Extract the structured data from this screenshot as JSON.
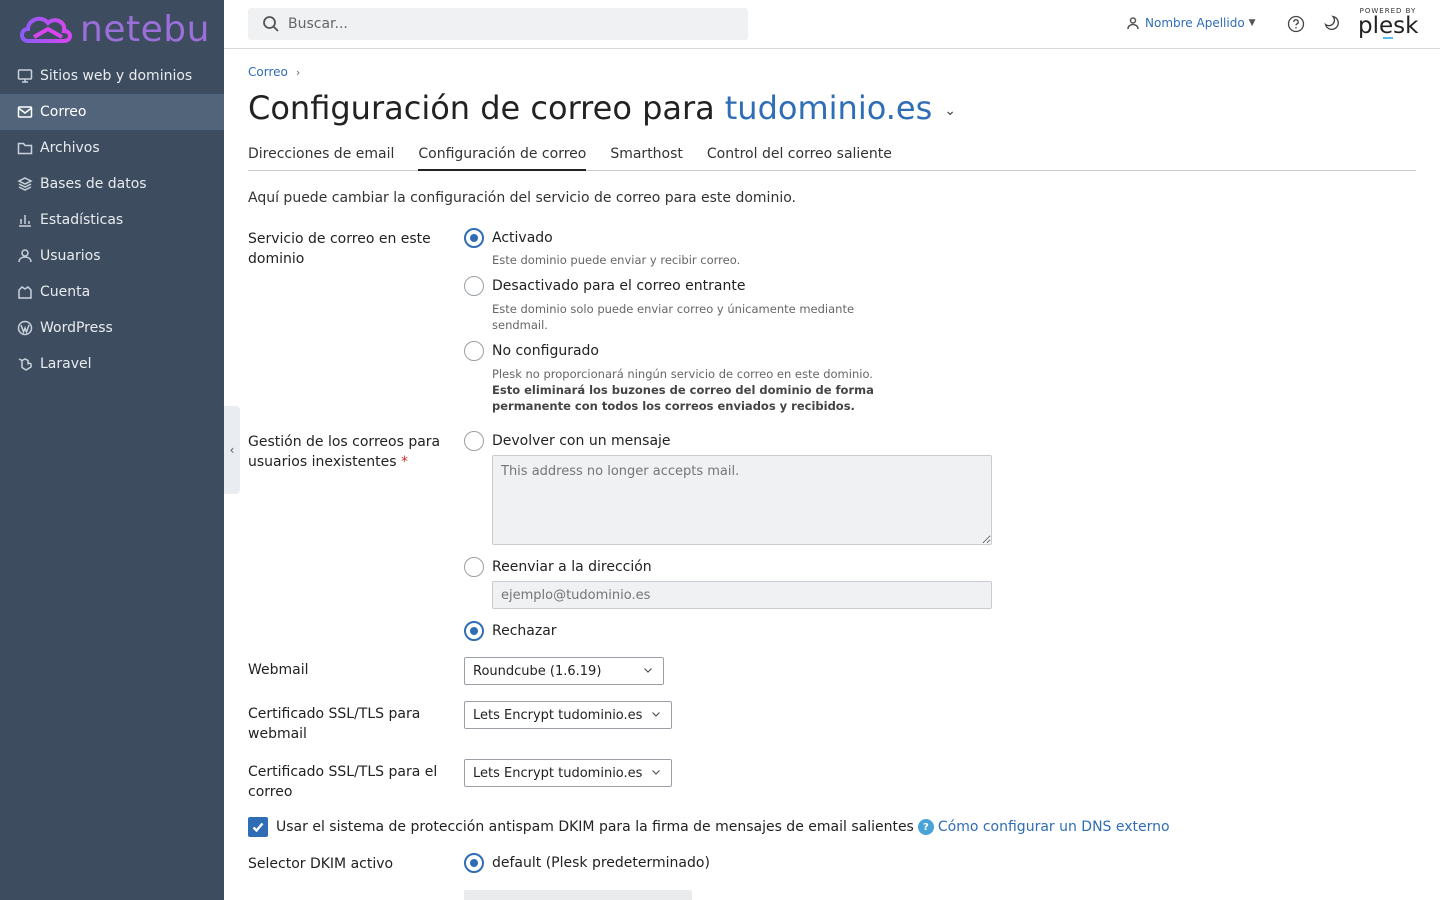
{
  "brand": {
    "name": "netebu",
    "accent": "#9b6fd9"
  },
  "sidebar": {
    "items": [
      {
        "label": "Sitios web y dominios",
        "icon": "monitor-icon"
      },
      {
        "label": "Correo",
        "icon": "mail-icon",
        "active": true
      },
      {
        "label": "Archivos",
        "icon": "folder-icon"
      },
      {
        "label": "Bases de datos",
        "icon": "database-icon"
      },
      {
        "label": "Estadísticas",
        "icon": "bar-chart-icon"
      },
      {
        "label": "Usuarios",
        "icon": "user-icon"
      },
      {
        "label": "Cuenta",
        "icon": "account-icon"
      },
      {
        "label": "WordPress",
        "icon": "wordpress-icon"
      },
      {
        "label": "Laravel",
        "icon": "laravel-icon"
      }
    ]
  },
  "header": {
    "search_placeholder": "Buscar...",
    "user_name": "Nombre Apellido",
    "powered_by": "POWERED BY",
    "plesk": "plesk"
  },
  "breadcrumb": {
    "item": "Correo"
  },
  "page": {
    "title": "Configuración de correo para",
    "domain": "tudominio.es"
  },
  "tabs": [
    {
      "label": "Direcciones de email"
    },
    {
      "label": "Configuración de correo",
      "active": true
    },
    {
      "label": "Smarthost"
    },
    {
      "label": "Control del correo saliente"
    }
  ],
  "form": {
    "intro": "Aquí puede cambiar la configuración del servicio de correo para este dominio.",
    "mail_service": {
      "label_line1": "Servicio de correo en este",
      "label_line2": "dominio",
      "options": [
        {
          "label": "Activado",
          "hint": "Este dominio puede enviar y recibir correo.",
          "checked": true
        },
        {
          "label": "Desactivado para el correo entrante",
          "hint_line1": "Este dominio solo puede enviar correo y únicamente mediante",
          "hint_line2": "sendmail.",
          "checked": false
        },
        {
          "label": "No configurado",
          "hint": "Plesk no proporcionará ningún servicio de correo en este dominio.",
          "hint_bold_line1": "Esto eliminará los buzones de correo del dominio de forma",
          "hint_bold_line2": "permanente con todos los correos enviados y recibidos.",
          "checked": false
        }
      ]
    },
    "nonexistent": {
      "label_line1": "Gestión de los correos para",
      "label_line2": "usuarios inexistentes",
      "required_mark": "*",
      "bounce_label": "Devolver con un mensaje",
      "bounce_placeholder": "This address no longer accepts mail.",
      "forward_label": "Reenviar a la dirección",
      "forward_placeholder": "ejemplo@tudominio.es",
      "reject_label": "Rechazar",
      "selected": "reject"
    },
    "webmail": {
      "label": "Webmail",
      "value": "Roundcube (1.6.19)"
    },
    "ssl_webmail": {
      "label_line1": "Certificado SSL/TLS para",
      "label_line2": "webmail",
      "value": "Lets Encrypt tudominio.es"
    },
    "ssl_mail": {
      "label_line1": "Certificado SSL/TLS para el",
      "label_line2": "correo",
      "value": "Lets Encrypt tudominio.es"
    },
    "dkim": {
      "checkbox_label": "Usar el sistema de protección antispam DKIM para la firma de mensajes de email salientes",
      "checked": true,
      "help_link": "Cómo configurar un DNS externo"
    },
    "dkim_selector": {
      "label": "Selector DKIM activo",
      "option": "default (Plesk predeterminado)",
      "checked": true
    }
  },
  "colors": {
    "sidebar_bg": "#3d4c5e",
    "sidebar_active": "#52647a",
    "link": "#2f6db5",
    "required": "#d02b2b"
  }
}
